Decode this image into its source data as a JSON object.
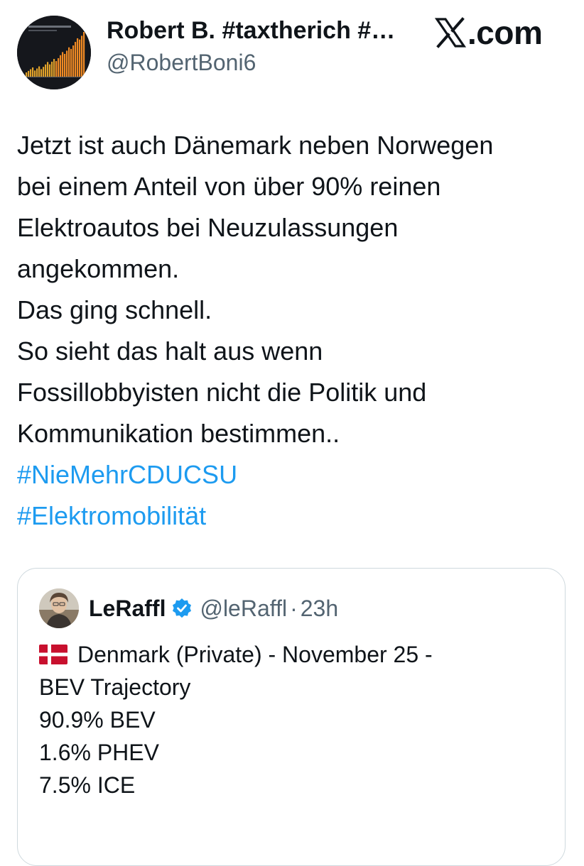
{
  "post": {
    "author_name": "Robert B. #taxtherich #…",
    "author_handle": "@RobertBoni6",
    "brand": ".com",
    "body_lines": [
      "Jetzt ist auch Dänemark neben Norwegen",
      "bei einem Anteil von über 90% reinen",
      "Elektroautos bei Neuzulassungen",
      "angekommen.",
      "Das ging schnell.",
      "So sieht das halt aus wenn",
      "Fossillobbyisten nicht die Politik und",
      "Kommunikation bestimmen.."
    ],
    "hashtags": [
      "#NieMehrCDUCSU",
      "#Elektromobilität"
    ]
  },
  "quote": {
    "author_name": "LeRaffl",
    "author_handle": "@leRaffl",
    "separator": "·",
    "time": "23h",
    "lines": [
      "Denmark (Private) - November 25 -",
      "BEV Trajectory",
      "90.9% BEV",
      "1.6% PHEV",
      "7.5% ICE"
    ]
  },
  "icons": {
    "avatar": "bar-chart-avatar",
    "brand": "x-logo-icon",
    "verified": "verified-badge-icon",
    "flag": "denmark-flag-icon"
  },
  "colors": {
    "hashtag": "#1d9bf0",
    "verified": "#1d9bf0",
    "secondary_text": "#536471",
    "card_border": "#cfd9de"
  }
}
